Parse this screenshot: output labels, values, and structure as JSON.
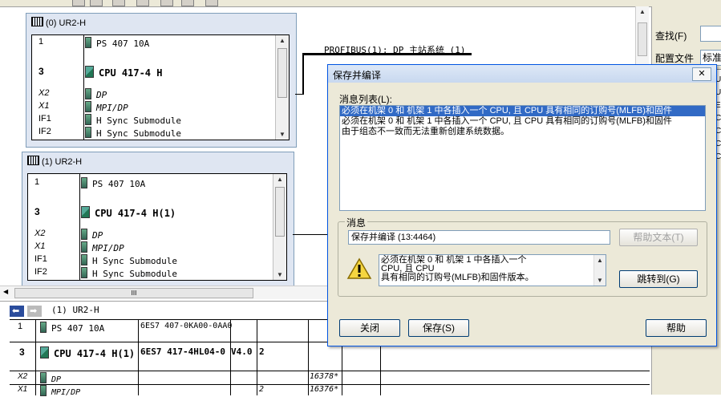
{
  "network": {
    "bus_label": "PROFIBUS(1): DP 主站系统 (1)"
  },
  "rack0": {
    "title": "(0) UR2-H",
    "rows": [
      {
        "slot": "1",
        "module": "PS 407 10A"
      },
      {
        "slot": "3",
        "module": "CPU 417-4 H"
      },
      {
        "slot": "X2",
        "module": "DP"
      },
      {
        "slot": "X1",
        "module": "MPI/DP"
      },
      {
        "slot": "IF1",
        "module": "H Sync Submodule"
      },
      {
        "slot": "IF2",
        "module": "H Sync Submodule"
      }
    ]
  },
  "rack1": {
    "title": "(1) UR2-H",
    "rows": [
      {
        "slot": "1",
        "module": "PS 407 10A"
      },
      {
        "slot": "3",
        "module": "CPU 417-4 H(1)"
      },
      {
        "slot": "X2",
        "module": "DP"
      },
      {
        "slot": "X1",
        "module": "MPI/DP"
      },
      {
        "slot": "IF1",
        "module": "H Sync Submodule"
      },
      {
        "slot": "IF2",
        "module": "H Sync Submodule"
      }
    ]
  },
  "hscroll": {
    "thumb_label": "III"
  },
  "right_panel": {
    "find_label": "查找(F)",
    "profile_label": "配置文件",
    "profile_value": "标准",
    "edge_letters": [
      "U",
      "U",
      "E",
      "C",
      "C",
      "C",
      "C"
    ]
  },
  "bottom_table": {
    "header": "(1)    UR2-H",
    "rows": [
      {
        "slot": "1",
        "module": "PS 407 10A",
        "order": "6ES7 407-0KA00-0AA0",
        "fw": "",
        "mpi": "",
        "addr": ""
      },
      {
        "slot": "3",
        "module": "CPU 417-4 H(1)",
        "order": "6ES7 417-4HL04-0",
        "fw": "V4.0",
        "mpi": "2",
        "addr": ""
      },
      {
        "slot": "X2",
        "module": "DP",
        "order": "",
        "fw": "",
        "mpi": "",
        "addr": "16378*"
      },
      {
        "slot": "X1",
        "module": "MPI/DP",
        "order": "",
        "fw": "",
        "mpi": "2",
        "addr": "16376*"
      }
    ]
  },
  "dialog": {
    "title": "保存并编译",
    "close": "✕",
    "list_label": "消息列表(L):",
    "messages": [
      "必须在机架 0 和 机架 1 中各插入一个 CPU, 且 CPU 具有相同的订购号(MLFB)和固件",
      "必须在机架 0 和 机架 1 中各插入一个 CPU, 且 CPU 具有相同的订购号(MLFB)和固件",
      "由于组态不一致而无法重新创建系统数据。"
    ],
    "group_label": "消息",
    "status": "保存并编译 (13:4464)",
    "help_text_button": "帮助文本(T)",
    "detail_lines": [
      "必须在机架 0 和 机架 1 中各插入一个",
      "CPU, 且 CPU",
      "具有相同的订购号(MLFB)和固件版本。"
    ],
    "goto_button": "跳转到(G)",
    "close_button": "关闭",
    "save_button": "保存(S)",
    "help_button": "帮助"
  }
}
